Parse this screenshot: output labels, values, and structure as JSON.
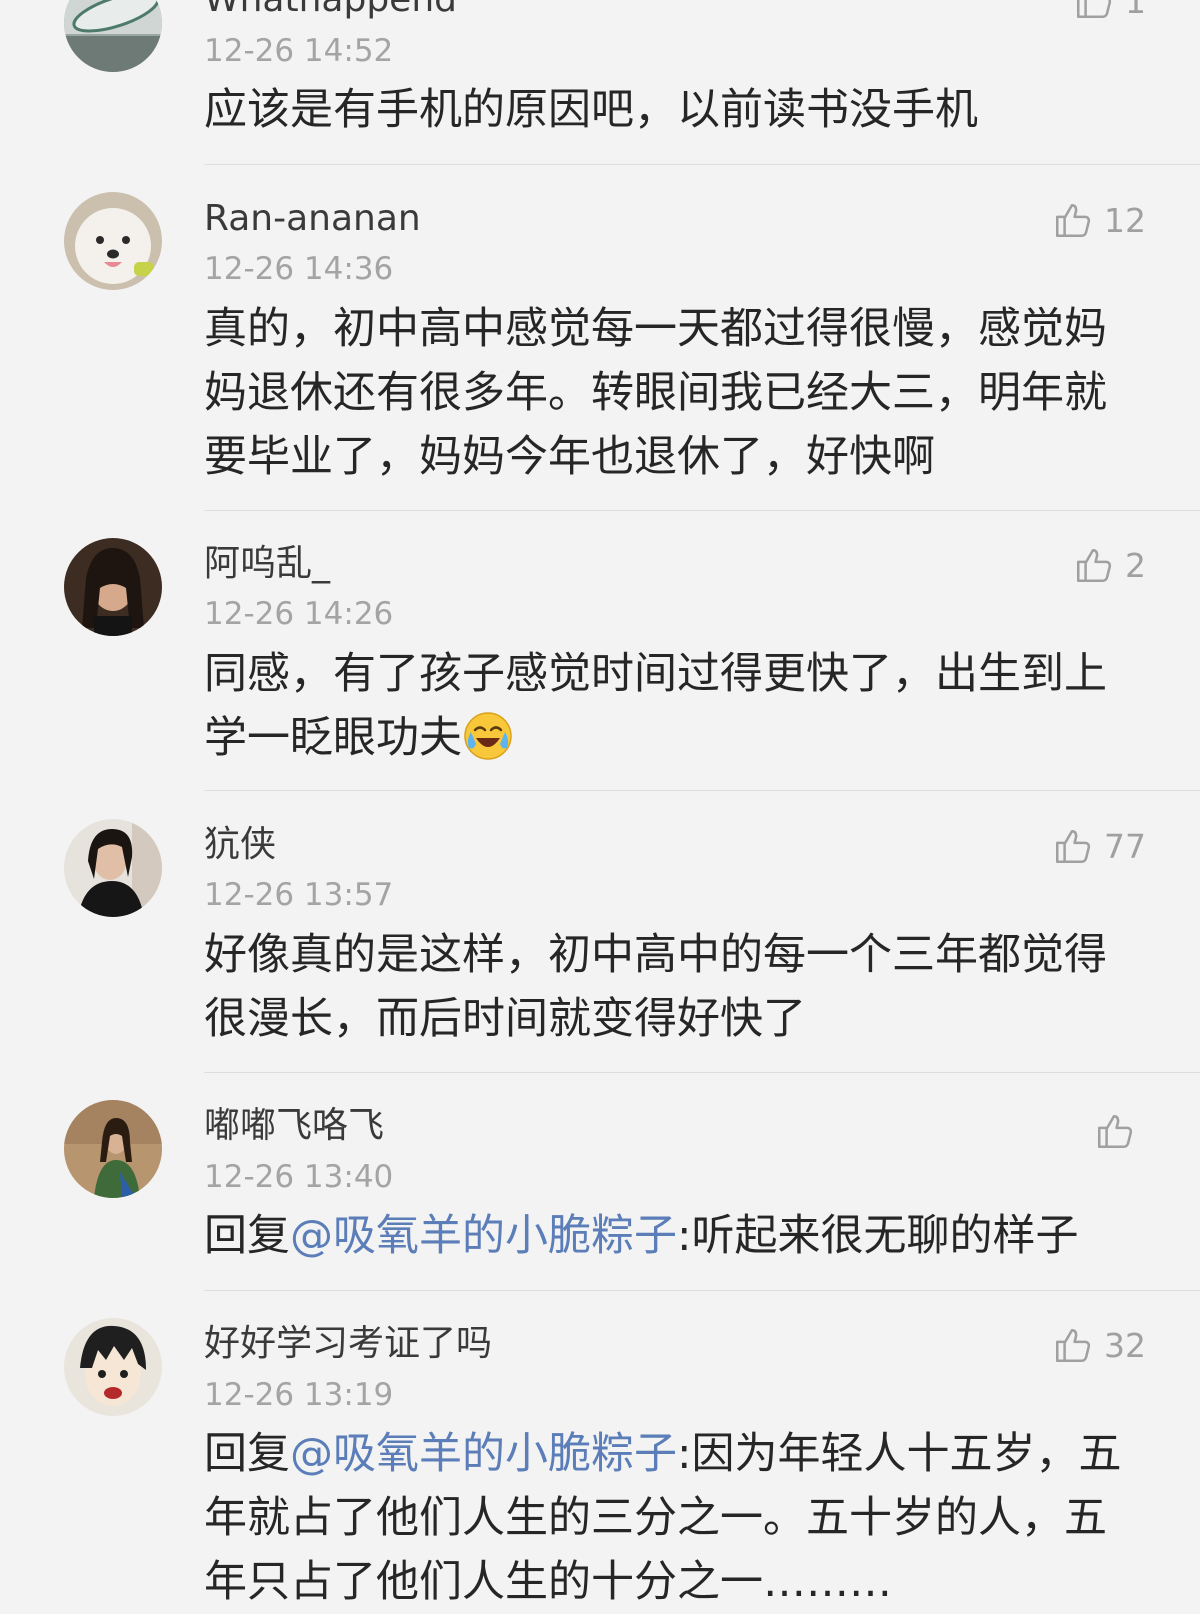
{
  "comments": [
    {
      "username": "Whathappend",
      "time": "12-26 14:52",
      "likes": "1",
      "body": "应该是有手机的原因吧，以前读书没手机"
    },
    {
      "username": "Ran-ananan",
      "time": "12-26 14:36",
      "likes": "12",
      "body": "真的，初中高中感觉每一天都过得很慢，感觉妈妈退休还有很多年。转眼间我已经大三，明年就要毕业了，妈妈今年也退休了，好快啊"
    },
    {
      "username": "阿呜乱_",
      "time": "12-26 14:26",
      "likes": "2",
      "body": "同感，有了孩子感觉时间过得更快了，出生到上学一眨眼功夫",
      "emoji": "laughing-crying-emoji"
    },
    {
      "username": "犺侠",
      "time": "12-26 13:57",
      "likes": "77",
      "body": "好像真的是这样，初中高中的每一个三年都觉得很漫长，而后时间就变得好快了"
    },
    {
      "username": "嘟嘟飞咯飞",
      "time": "12-26 13:40",
      "likes": "",
      "reply_prefix": "回复",
      "mention": "@吸氧羊的小脆粽子",
      "body": ":听起来很无聊的样子"
    },
    {
      "username": "好好学习考证了吗",
      "time": "12-26 13:19",
      "likes": "32",
      "reply_prefix": "回复",
      "mention": "@吸氧羊的小脆粽子",
      "body": ":因为年轻人十五岁，五年就占了他们人生的三分之一。五十岁的人，五年只占了他们人生的十分之一………"
    }
  ],
  "icons": {
    "like": "thumbs-up-outline-icon"
  },
  "colors": {
    "background": "#f3f3f3",
    "mention": "#5b7db8",
    "meta": "#a4a4a4",
    "divider": "#dedede"
  }
}
